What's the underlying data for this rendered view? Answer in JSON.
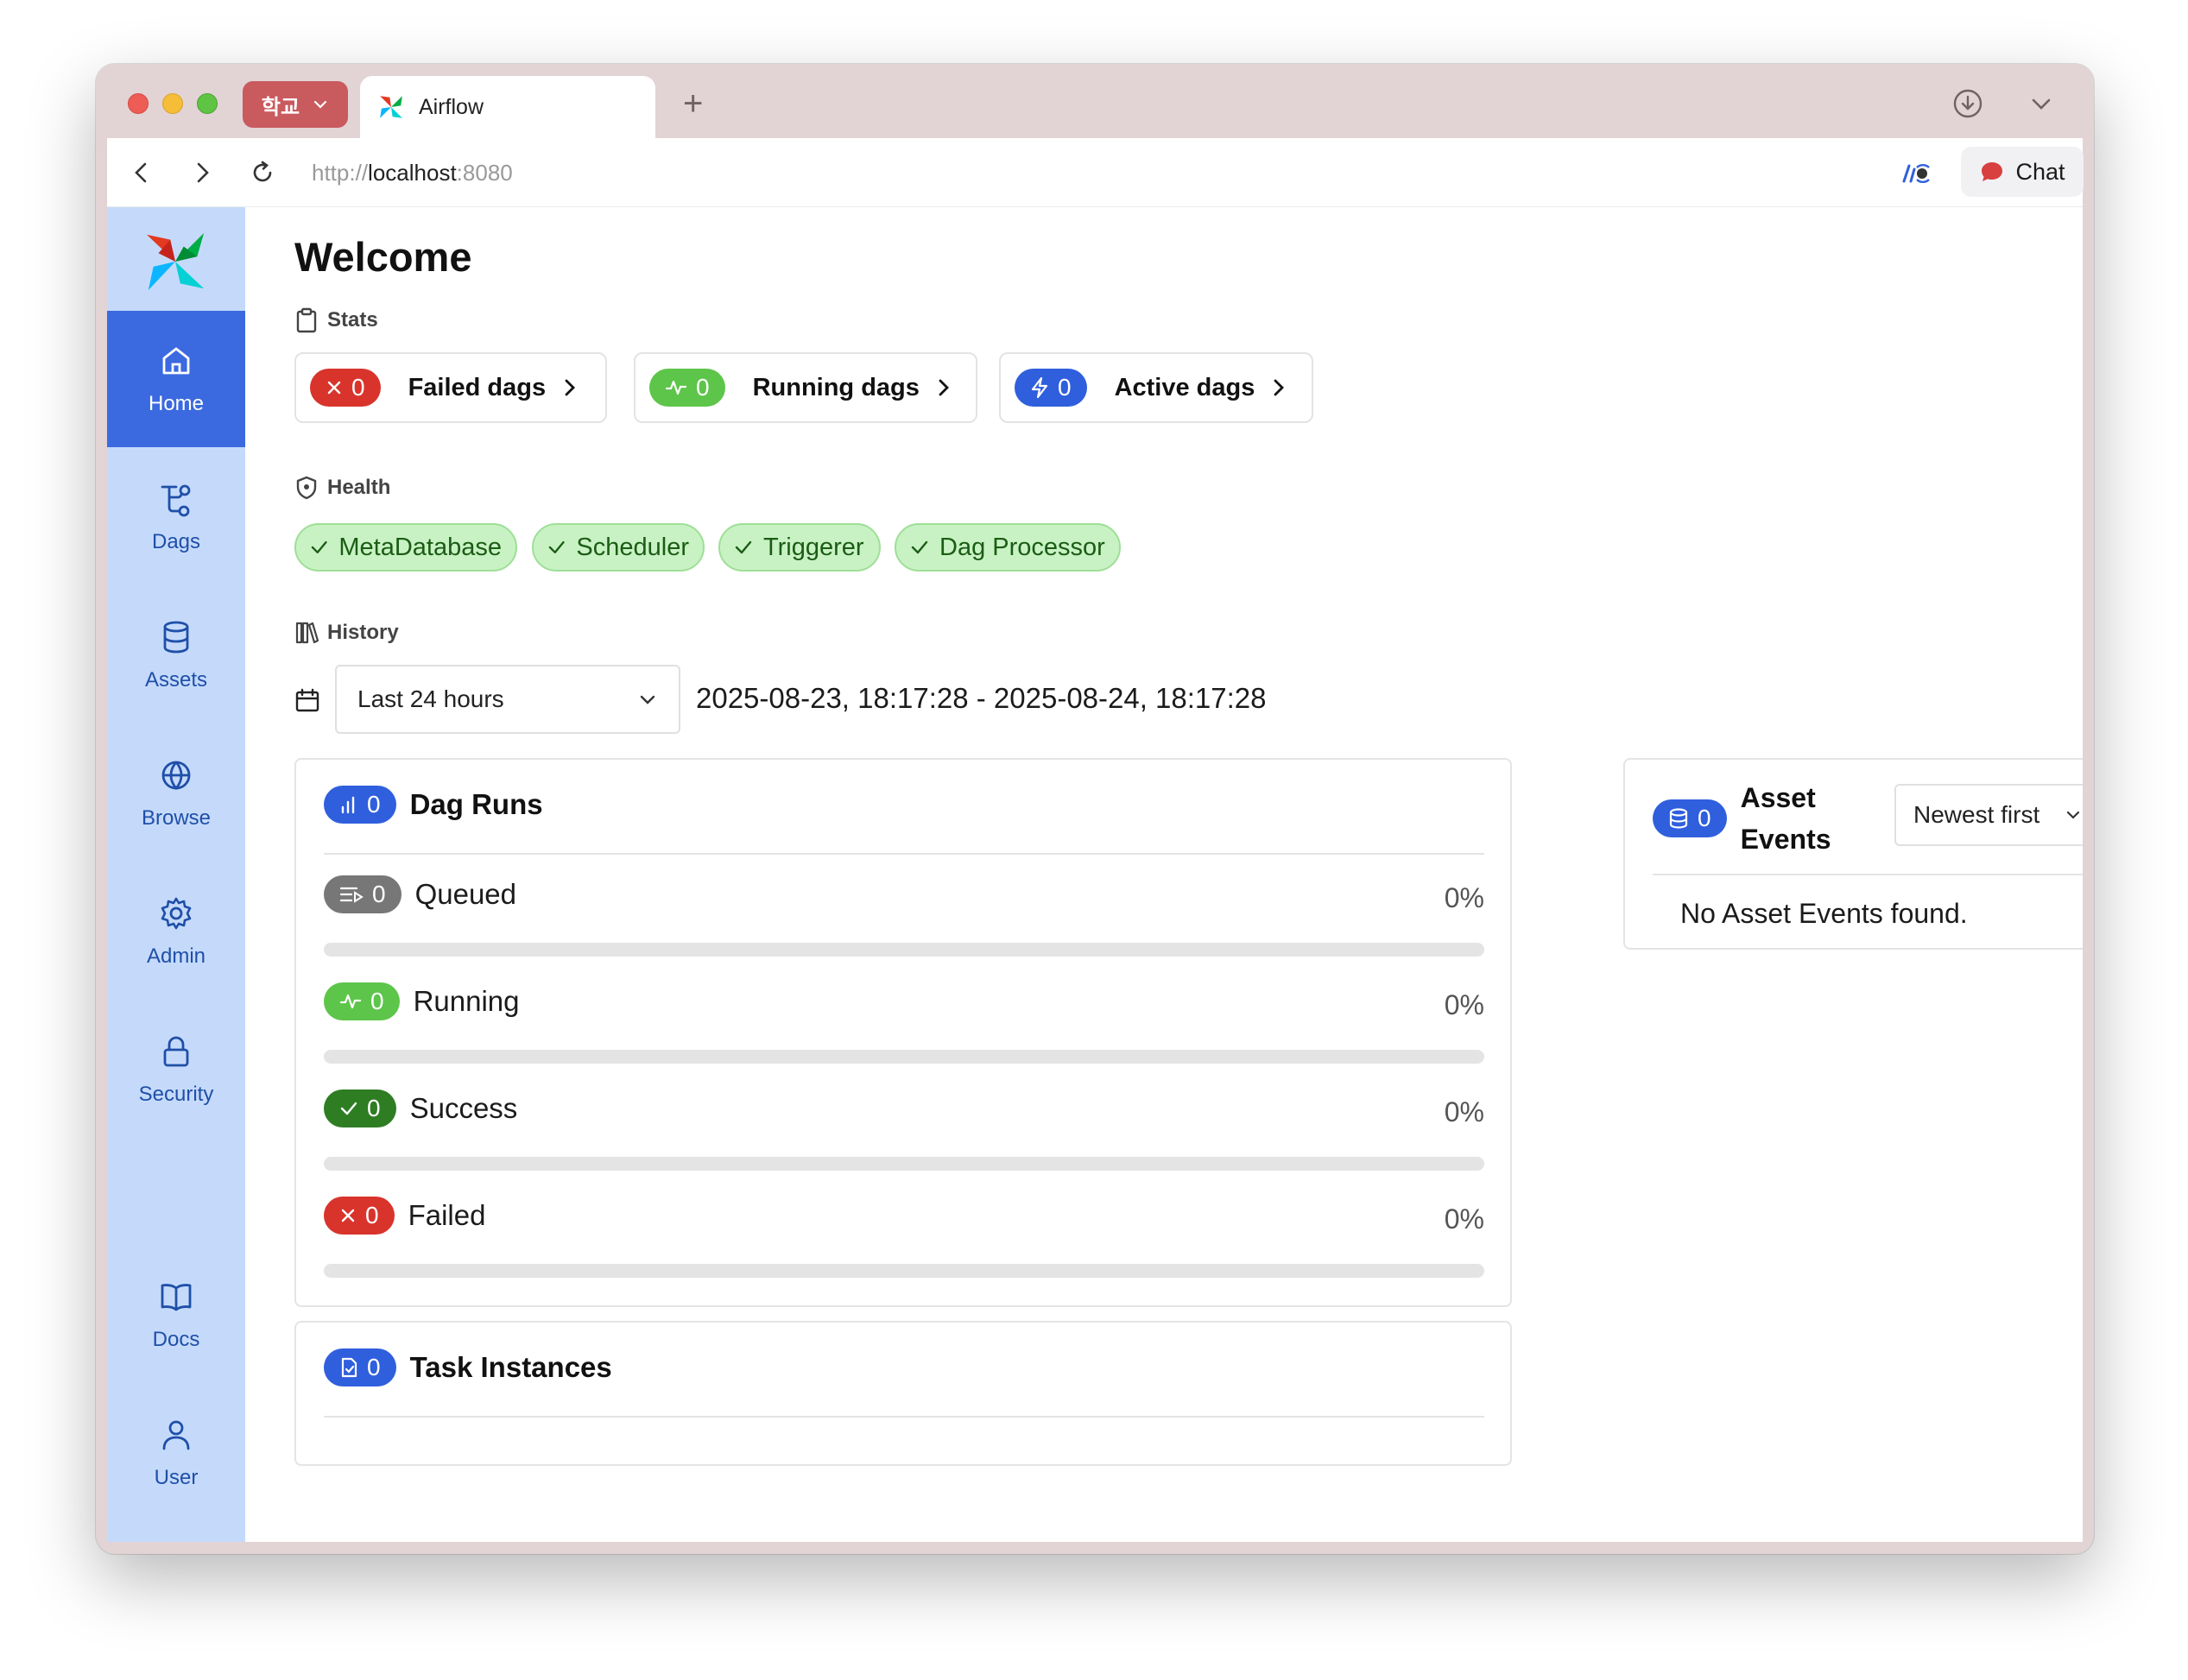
{
  "browser": {
    "profile_label": "학교",
    "tab_title": "Airflow",
    "url_scheme": "http://",
    "url_host": "localhost",
    "url_port": ":8080",
    "chat_label": "Chat"
  },
  "sidebar": {
    "items": [
      {
        "label": "Home",
        "icon": "home-icon"
      },
      {
        "label": "Dags",
        "icon": "dag-icon"
      },
      {
        "label": "Assets",
        "icon": "database-icon"
      },
      {
        "label": "Browse",
        "icon": "globe-icon"
      },
      {
        "label": "Admin",
        "icon": "gear-icon"
      },
      {
        "label": "Security",
        "icon": "lock-icon"
      },
      {
        "label": "Docs",
        "icon": "book-icon"
      },
      {
        "label": "User",
        "icon": "user-icon"
      }
    ]
  },
  "page": {
    "title": "Welcome"
  },
  "stats": {
    "label": "Stats",
    "cards": [
      {
        "count": "0",
        "label": "Failed dags"
      },
      {
        "count": "0",
        "label": "Running dags"
      },
      {
        "count": "0",
        "label": "Active dags"
      }
    ]
  },
  "health": {
    "label": "Health",
    "items": [
      "MetaDatabase",
      "Scheduler",
      "Triggerer",
      "Dag Processor"
    ]
  },
  "history": {
    "label": "History",
    "range_selected": "Last 24 hours",
    "range_text": "2025-08-23, 18:17:28 - 2025-08-24, 18:17:28"
  },
  "dag_runs": {
    "count": "0",
    "title": "Dag Runs",
    "rows": [
      {
        "count": "0",
        "label": "Queued",
        "pct": "0%",
        "fraction": 0
      },
      {
        "count": "0",
        "label": "Running",
        "pct": "0%",
        "fraction": 0
      },
      {
        "count": "0",
        "label": "Success",
        "pct": "0%",
        "fraction": 0
      },
      {
        "count": "0",
        "label": "Failed",
        "pct": "0%",
        "fraction": 0
      }
    ]
  },
  "task_instances": {
    "count": "0",
    "title": "Task Instances"
  },
  "asset_events": {
    "count": "0",
    "title_line1": "Asset",
    "title_line2": "Events",
    "sort_selected": "Newest first",
    "empty_message": "No Asset Events found."
  },
  "colors": {
    "sidebar_bg": "#c5dafb",
    "sidebar_active": "#3b6ae0",
    "failed": "#d8342c",
    "running": "#5dc54a",
    "active": "#2f5fdd",
    "queued": "#777777",
    "success": "#2e7d23",
    "health_bg": "#c8f2c4"
  }
}
